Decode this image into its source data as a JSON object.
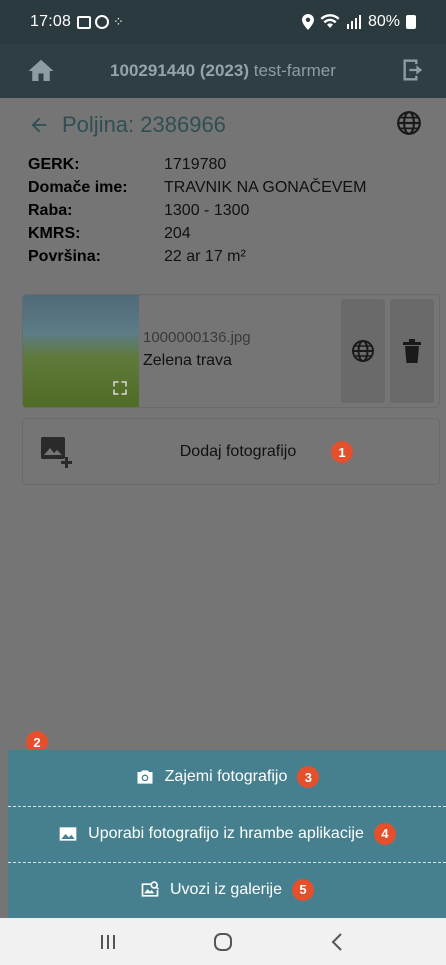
{
  "status_bar": {
    "time": "17:08",
    "battery": "80%"
  },
  "header": {
    "id_label": "100291440 (2023)",
    "user": "test-farmer"
  },
  "page": {
    "title": "Poljina: 2386966"
  },
  "details": [
    {
      "key": "GERK:",
      "value": "1719780"
    },
    {
      "key": "Domače ime:",
      "value": "TRAVNIK NA GONAČEVEM"
    },
    {
      "key": "Raba:",
      "value": "1300 - 1300"
    },
    {
      "key": "KMRS:",
      "value": "204"
    },
    {
      "key": "Površina:",
      "value": "22 ar 17 m²"
    }
  ],
  "photo": {
    "filename": "1000000136.jpg",
    "description": "Zelena trava"
  },
  "add_photo": {
    "label": "Dodaj fotografijo",
    "badge": "1"
  },
  "overlay_badge": "2",
  "sheet": {
    "options": [
      {
        "label": "Zajemi fotografijo",
        "badge": "3"
      },
      {
        "label": "Uporabi fotografijo iz hrambe aplikacije",
        "badge": "4"
      },
      {
        "label": "Uvozi iz galerije",
        "badge": "5"
      }
    ]
  },
  "colors": {
    "accent": "#46808e",
    "badge": "#e4502c",
    "header": "#2e3e44"
  }
}
